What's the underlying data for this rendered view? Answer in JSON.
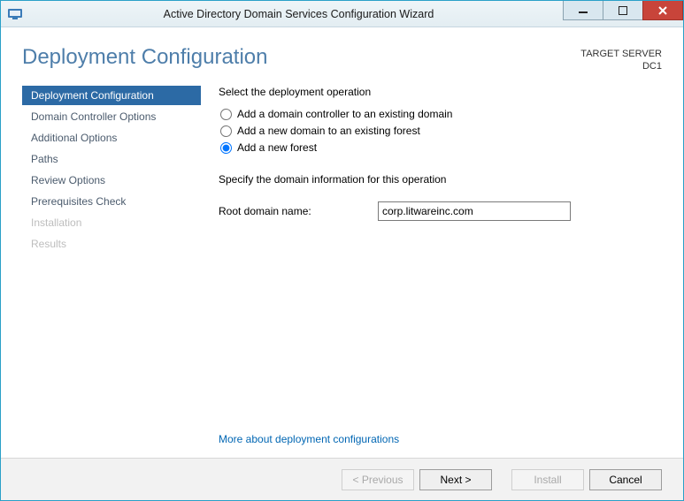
{
  "window": {
    "title": "Active Directory Domain Services Configuration Wizard"
  },
  "header": {
    "page_title": "Deployment Configuration",
    "target_server_label": "TARGET SERVER",
    "target_server_value": "DC1"
  },
  "sidebar": {
    "items": [
      {
        "label": "Deployment Configuration",
        "state": "active"
      },
      {
        "label": "Domain Controller Options",
        "state": "normal"
      },
      {
        "label": "Additional Options",
        "state": "normal"
      },
      {
        "label": "Paths",
        "state": "normal"
      },
      {
        "label": "Review Options",
        "state": "normal"
      },
      {
        "label": "Prerequisites Check",
        "state": "normal"
      },
      {
        "label": "Installation",
        "state": "disabled"
      },
      {
        "label": "Results",
        "state": "disabled"
      }
    ]
  },
  "form": {
    "select_op_label": "Select the deployment operation",
    "radios": {
      "existing_domain": "Add a domain controller to an existing domain",
      "existing_forest": "Add a new domain to an existing forest",
      "new_forest": "Add a new forest"
    },
    "selected_radio": "new_forest",
    "specify_label": "Specify the domain information for this operation",
    "root_domain_label": "Root domain name:",
    "root_domain_value": "corp.litwareinc.com",
    "more_link": "More about deployment configurations"
  },
  "buttons": {
    "previous": "< Previous",
    "next": "Next >",
    "install": "Install",
    "cancel": "Cancel"
  }
}
